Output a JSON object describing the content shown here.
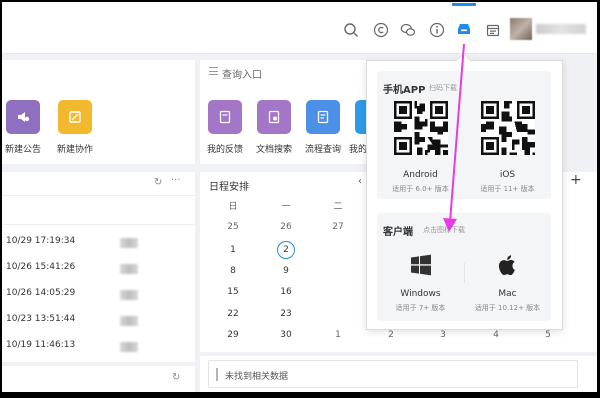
{
  "colors": {
    "accent": "#1f8ceb",
    "arrow": "#e83ae6"
  },
  "topbar": {
    "icons": [
      "search-icon",
      "copyright-icon",
      "wechat-icon",
      "info-circle-icon",
      "download-client-icon",
      "calendar-icon"
    ],
    "active_icon": "download-client-icon"
  },
  "apps_left": [
    {
      "label": "新建公告",
      "color": "#8e6fc0",
      "icon": "announcement-icon"
    },
    {
      "label": "新建协作",
      "color": "#f2b92e",
      "icon": "collaboration-icon"
    }
  ],
  "query": {
    "title": "查询入口",
    "apps": [
      {
        "label": "我的反馈",
        "color": "#a376c8",
        "icon": "feedback-icon"
      },
      {
        "label": "文档搜索",
        "color": "#a376c8",
        "icon": "document-search-icon"
      },
      {
        "label": "流程查询",
        "color": "#4c8fe6",
        "icon": "process-query-icon"
      },
      {
        "label": "我的",
        "color": "#2e9be8",
        "icon": "my-icon"
      }
    ]
  },
  "recent_list": {
    "rows": [
      {
        "time": "10/29 17:19:34"
      },
      {
        "time": "10/26 15:41:26"
      },
      {
        "time": "10/26 14:05:29"
      },
      {
        "time": "10/23 13:51:44"
      },
      {
        "time": "10/19 11:46:13"
      }
    ]
  },
  "schedule": {
    "title": "日程安排",
    "weekdays": [
      "日",
      "一",
      "二"
    ],
    "weeks": [
      [
        "25",
        "26",
        "27"
      ],
      [
        "1",
        "2",
        ""
      ],
      [
        "8",
        "9",
        ""
      ],
      [
        "15",
        "16",
        ""
      ],
      [
        "22",
        "23",
        ""
      ],
      [
        "29",
        "30",
        "1",
        "2",
        "3",
        "4",
        "5"
      ]
    ],
    "today": "2"
  },
  "bottom": {
    "empty_text": "未找到相关数据"
  },
  "popover": {
    "mobile": {
      "title": "手机APP",
      "subtitle": "扫码下载",
      "items": [
        {
          "name": "Android",
          "version": "适用于 6.0+ 版本",
          "icon": "android-qr-code"
        },
        {
          "name": "iOS",
          "version": "适用于 11+ 版本",
          "icon": "ios-qr-code"
        }
      ]
    },
    "desktop": {
      "title": "客户端",
      "subtitle": "点击图标下载",
      "items": [
        {
          "name": "Windows",
          "version": "适用于 7+ 版本",
          "icon": "windows-icon"
        },
        {
          "name": "Mac",
          "version": "适用于 10.12+ 版本",
          "icon": "apple-icon"
        }
      ]
    }
  }
}
